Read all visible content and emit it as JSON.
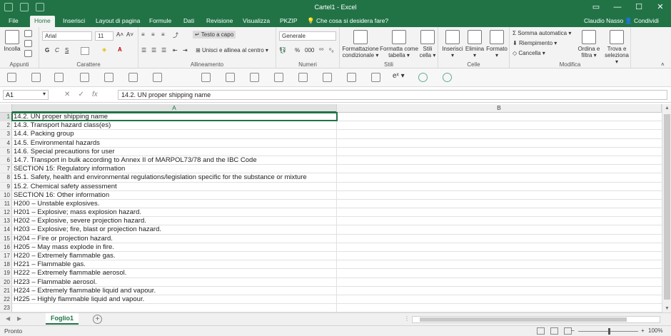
{
  "window": {
    "title": "Cartel1 - Excel"
  },
  "tabs": [
    "File",
    "Home",
    "Inserisci",
    "Layout di pagina",
    "Formule",
    "Dati",
    "Revisione",
    "Visualizza",
    "PKZIP"
  ],
  "tell_me": "Che cosa si desidera fare?",
  "user": "Claudio Nasso",
  "share_label": "Condividi",
  "ribbon": {
    "clipboard": {
      "paste": "Incolla",
      "label": "Appunti"
    },
    "font": {
      "name": "Arial",
      "size": "11",
      "label": "Carattere",
      "bold": "G",
      "italic": "C",
      "underline": "S"
    },
    "alignment": {
      "wrap": "Testo a capo",
      "merge": "Unisci e allinea al centro",
      "label": "Allineamento"
    },
    "number": {
      "format": "Generale",
      "label": "Numeri"
    },
    "styles": {
      "conditional_l1": "Formattazione",
      "conditional_l2": "condizionale",
      "table_l1": "Formatta come",
      "table_l2": "tabella",
      "cell_l1": "Stili",
      "cell_l2": "cella",
      "label": "Stili"
    },
    "cells": {
      "insert": "Inserisci",
      "delete": "Elimina",
      "format": "Formato",
      "label": "Celle"
    },
    "editing": {
      "autosum": "Somma automatica",
      "fill": "Riempimento",
      "clear": "Cancella",
      "sort_l1": "Ordina e",
      "sort_l2": "filtra",
      "find_l1": "Trova e",
      "find_l2": "seleziona",
      "label": "Modifica"
    }
  },
  "formula_bar": {
    "name_box": "A1",
    "fx": "fx",
    "content": "14.2. UN proper shipping name"
  },
  "columns": [
    "A",
    "B"
  ],
  "rows": [
    "14.2. UN proper shipping name",
    "14.3. Transport hazard class(es)",
    "14.4. Packing group",
    "14.5. Environmental hazards",
    "14.6. Special precautions for user",
    "14.7. Transport in bulk according to Annex II of MARPOL73/78 and the IBC Code",
    "SECTION 15: Regulatory information",
    "15.1. Safety, health and environmental regulations/legislation specific for the substance or mixture",
    "15.2. Chemical safety assessment",
    "SECTION 16: Other information",
    "H200 – Unstable explosives.",
    "H201 – Explosive; mass explosion hazard.",
    "H202 – Explosive, severe projection hazard.",
    "H203 – Explosive; fire, blast or projection hazard.",
    "H204 – Fire or projection hazard.",
    "H205 – May mass explode in fire.",
    "H220 – Extremely flammable gas.",
    "H221 – Flammable gas.",
    "H222 – Extremely flammable aerosol.",
    "H223 – Flammable aerosol.",
    "H224 – Extremely flammable liquid and vapour.",
    "H225 – Highly flammable liquid and vapour.",
    ""
  ],
  "sheet_tab": "Foglio1",
  "status": {
    "ready": "Pronto",
    "zoom": "100%"
  }
}
